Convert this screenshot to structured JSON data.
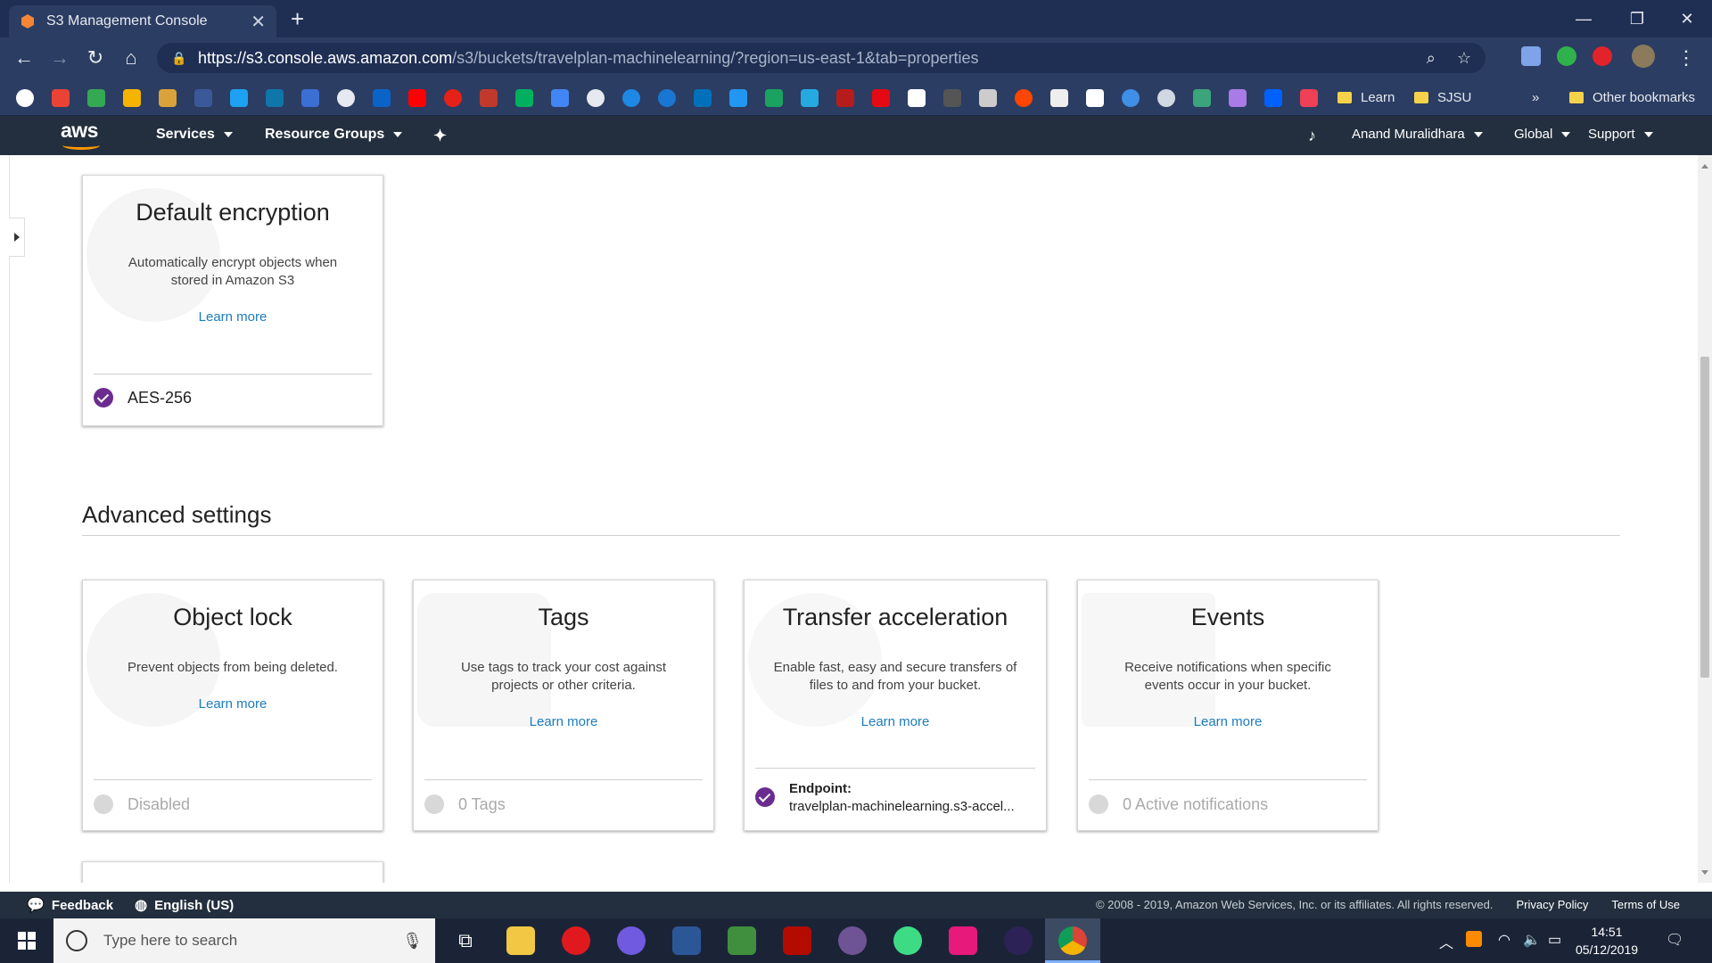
{
  "browser": {
    "tab_title": "S3 Management Console",
    "url_host": "https://s3.console.aws.amazon.com",
    "url_path": "/s3/buckets/travelplan-machinelearning/?region=us-east-1&tab=properties",
    "bookmark_folders": [
      "Learn",
      "SJSU"
    ],
    "overflow": "»",
    "other_bookmarks": "Other bookmarks"
  },
  "aws_nav": {
    "logo": "aws",
    "services": "Services",
    "resource_groups": "Resource Groups",
    "user": "Anand Muralidhara",
    "region": "Global",
    "support": "Support"
  },
  "default_encryption": {
    "title": "Default encryption",
    "description": "Automatically encrypt objects when stored in Amazon S3",
    "link": "Learn more",
    "status": "AES-256",
    "enabled": true
  },
  "advanced": {
    "heading": "Advanced settings",
    "cards": [
      {
        "title": "Object lock",
        "description": "Prevent objects from being deleted.",
        "link": "Learn more",
        "status": "Disabled",
        "enabled": false
      },
      {
        "title": "Tags",
        "description": "Use tags to track your cost against projects or other criteria.",
        "link": "Learn more",
        "status": "0 Tags",
        "enabled": false
      },
      {
        "title": "Transfer acceleration",
        "description": "Enable fast, easy and secure transfers of files to and from your bucket.",
        "link": "Learn more",
        "status_label": "Endpoint:",
        "status": "travelplan-machinelearning.s3-accel...",
        "enabled": true
      },
      {
        "title": "Events",
        "description": "Receive notifications when specific events occur in your bucket.",
        "link": "Learn more",
        "status": "0 Active notifications",
        "enabled": false
      }
    ]
  },
  "footer": {
    "feedback": "Feedback",
    "language": "English (US)",
    "copyright": "© 2008 - 2019, Amazon Web Services, Inc. or its affiliates. All rights reserved.",
    "privacy": "Privacy Policy",
    "terms": "Terms of Use"
  },
  "taskbar": {
    "search_placeholder": "Type here to search",
    "time": "14:51",
    "date": "05/12/2019"
  },
  "colors": {
    "aws_nav": "#232f3e",
    "aws_orange": "#ff9900",
    "link_blue": "#1c7cbd",
    "check_purple": "#6b2c8f",
    "chrome_dark": "#1f2f54"
  }
}
